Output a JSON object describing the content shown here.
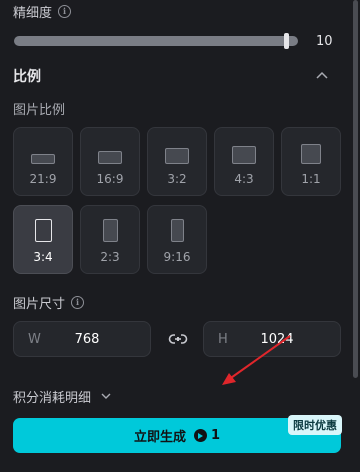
{
  "fineness": {
    "label": "精细度",
    "value": "10",
    "fraction": 0.95
  },
  "ratio_section": {
    "title": "比例",
    "sub_label": "图片比例"
  },
  "ratios": [
    {
      "label": "21:9",
      "selected": false
    },
    {
      "label": "16:9",
      "selected": false
    },
    {
      "label": "3:2",
      "selected": false
    },
    {
      "label": "4:3",
      "selected": false
    },
    {
      "label": "1:1",
      "selected": false
    },
    {
      "label": "3:4",
      "selected": true
    },
    {
      "label": "2:3",
      "selected": false
    },
    {
      "label": "9:16",
      "selected": false
    }
  ],
  "size": {
    "label": "图片尺寸",
    "width_prefix": "W",
    "width_value": "768",
    "height_prefix": "H",
    "height_value": "1024"
  },
  "cost": {
    "label": "积分消耗明细"
  },
  "generate": {
    "label": "立即生成",
    "credits": "1",
    "badge": "限时优惠"
  },
  "colors": {
    "accent": "#00c9da",
    "annotation_arrow": "#e0262b"
  }
}
